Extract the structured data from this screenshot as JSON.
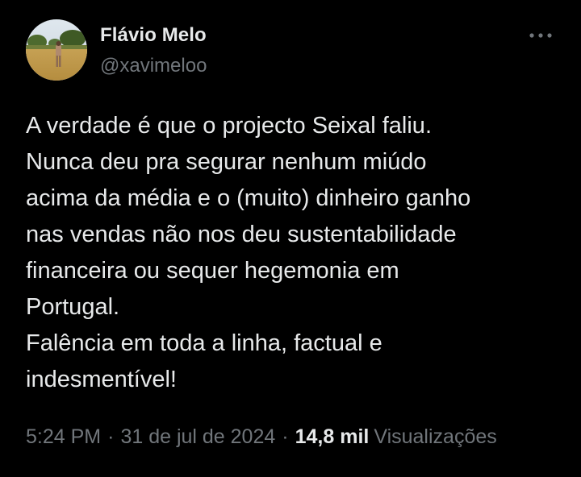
{
  "author": {
    "display_name": "Flávio Melo",
    "handle": "@xavimeloo"
  },
  "tweet": {
    "text": "A verdade é que o projecto Seixal faliu.\nNunca deu pra segurar nenhum miúdo\nacima da média e o (muito) dinheiro ganho\nnas vendas não nos deu sustentabilidade\nfinanceira ou sequer hegemonia em\nPortugal.\nFalência em toda a linha, factual e\nindesmentível!"
  },
  "meta": {
    "time": "5:24 PM",
    "separator": "·",
    "date": "31 de jul de 2024",
    "views_count": "14,8 mil",
    "views_label": "Visualizações"
  },
  "icons": {
    "more": "more-horizontal-icon",
    "avatar": "avatar-photo"
  },
  "colors": {
    "background": "#000000",
    "primary_text": "#e7e9ea",
    "secondary_text": "#71767b"
  }
}
